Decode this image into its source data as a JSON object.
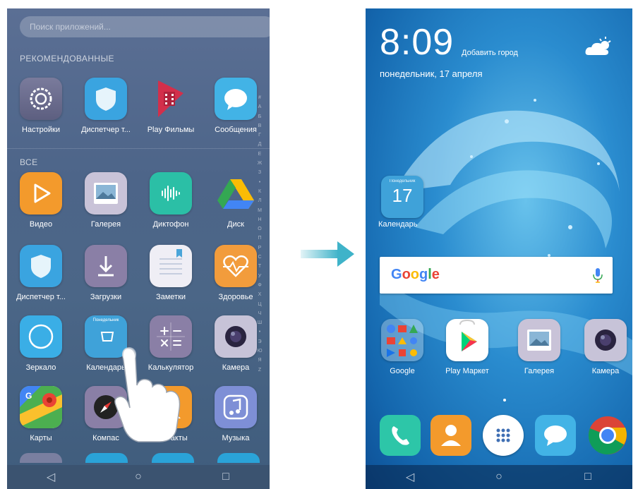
{
  "left_screen": {
    "search_placeholder": "Поиск приложений...",
    "recommended_label": "РЕКОМЕНДОВАННЫЕ",
    "all_label": "ВСЕ",
    "recommended_apps": [
      {
        "label": "Настройки",
        "icon": "settings-icon"
      },
      {
        "label": "Диспетчер т...",
        "icon": "shield-icon"
      },
      {
        "label": "Play Фильмы",
        "icon": "play-movies-icon"
      },
      {
        "label": "Сообщения",
        "icon": "messages-icon"
      }
    ],
    "apps": [
      {
        "label": "Видео",
        "icon": "video-icon"
      },
      {
        "label": "Галерея",
        "icon": "gallery-icon"
      },
      {
        "label": "Диктофон",
        "icon": "recorder-icon"
      },
      {
        "label": "Диск",
        "icon": "drive-icon"
      },
      {
        "label": "Диспетчер т...",
        "icon": "shield-icon"
      },
      {
        "label": "Загрузки",
        "icon": "downloads-icon"
      },
      {
        "label": "Заметки",
        "icon": "notes-icon"
      },
      {
        "label": "Здоровье",
        "icon": "health-icon"
      },
      {
        "label": "Зеркало",
        "icon": "mirror-icon"
      },
      {
        "label": "Календарь",
        "icon": "calendar-icon"
      },
      {
        "label": "Калькулятор",
        "icon": "calculator-icon"
      },
      {
        "label": "Камера",
        "icon": "camera-icon"
      },
      {
        "label": "Карты",
        "icon": "maps-icon"
      },
      {
        "label": "Компас",
        "icon": "compass-icon"
      },
      {
        "label": "Контакты",
        "icon": "contacts-icon"
      },
      {
        "label": "Музыка",
        "icon": "music-icon"
      }
    ],
    "alphabet": "#АБВГДЕЖЗ•КЛМНОПРСТУФХЦЧШ•ЭЮЯZ",
    "calendar_icon_caption": "Понедельник"
  },
  "right_screen": {
    "time": "8:09",
    "add_city": "Добавить город",
    "date": "понедельник, 17 апреля",
    "calendar_widget": {
      "day_name": "Понедельник",
      "day": "17",
      "label": "Календарь"
    },
    "google_logo": "Google",
    "home_apps": [
      {
        "label": "Google",
        "icon": "google-folder-icon"
      },
      {
        "label": "Play Маркет",
        "icon": "play-store-icon"
      },
      {
        "label": "Галерея",
        "icon": "gallery-icon"
      },
      {
        "label": "Камера",
        "icon": "camera-icon"
      }
    ],
    "dock": [
      "phone-icon",
      "contacts-icon",
      "app-drawer-icon",
      "messages-icon",
      "chrome-icon"
    ]
  },
  "nav": {
    "back": "◁",
    "home": "○",
    "recent": "□"
  },
  "colors": {
    "arrow": "#3fb3c9",
    "google_blue": "#4285f4",
    "google_red": "#ea4335",
    "google_yellow": "#fbbc05",
    "google_green": "#34a853"
  }
}
